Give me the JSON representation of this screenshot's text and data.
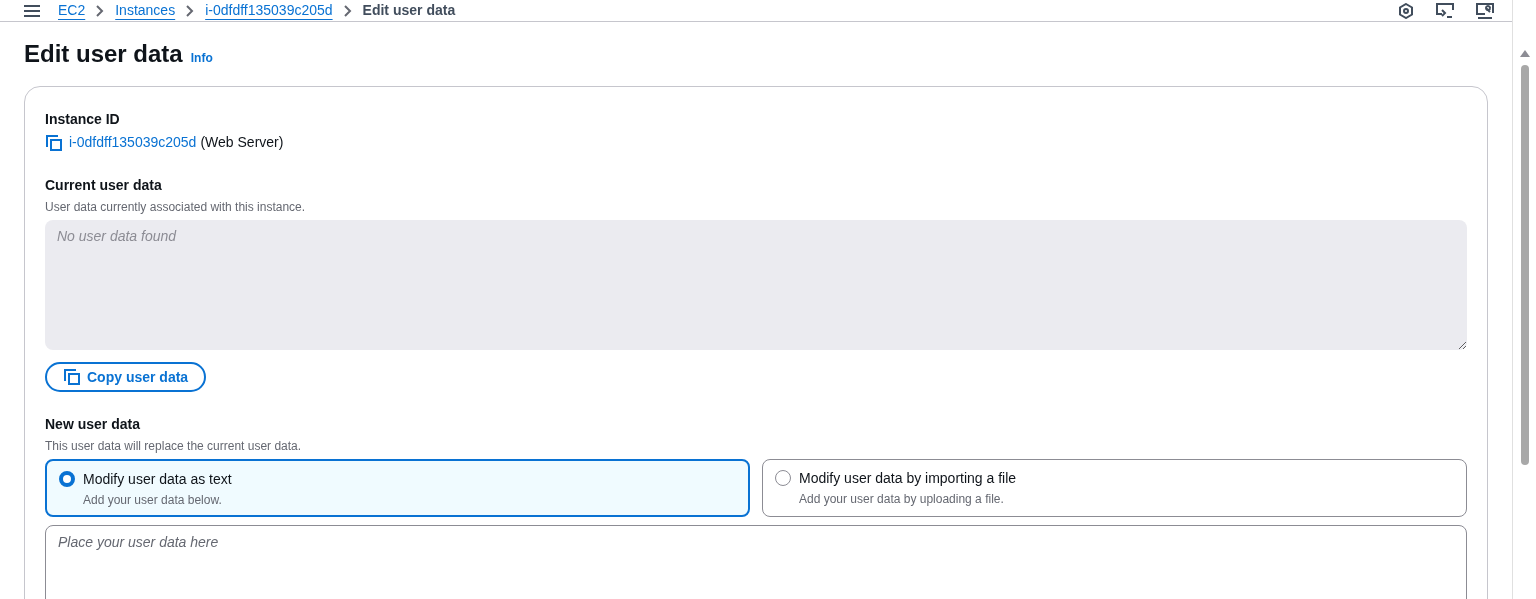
{
  "breadcrumbs": [
    {
      "label": "EC2",
      "link": true
    },
    {
      "label": "Instances",
      "link": true
    },
    {
      "label": "i-0dfdff135039c205d",
      "link": true
    },
    {
      "label": "Edit user data",
      "link": false
    }
  ],
  "page_title": "Edit user data",
  "info_link": "Info",
  "instance": {
    "label": "Instance ID",
    "id": "i-0dfdff135039c205d",
    "name": "(Web Server)"
  },
  "current_user_data": {
    "label": "Current user data",
    "description": "User data currently associated with this instance.",
    "placeholder": "No user data found"
  },
  "copy_button": "Copy user data",
  "new_user_data": {
    "label": "New user data",
    "description": "This user data will replace the current user data.",
    "options": [
      {
        "title": "Modify user data as text",
        "description": "Add your user data below.",
        "selected": true
      },
      {
        "title": "Modify user data by importing a file",
        "description": "Add your user data by uploading a file.",
        "selected": false
      }
    ],
    "placeholder": "Place your user data here"
  }
}
